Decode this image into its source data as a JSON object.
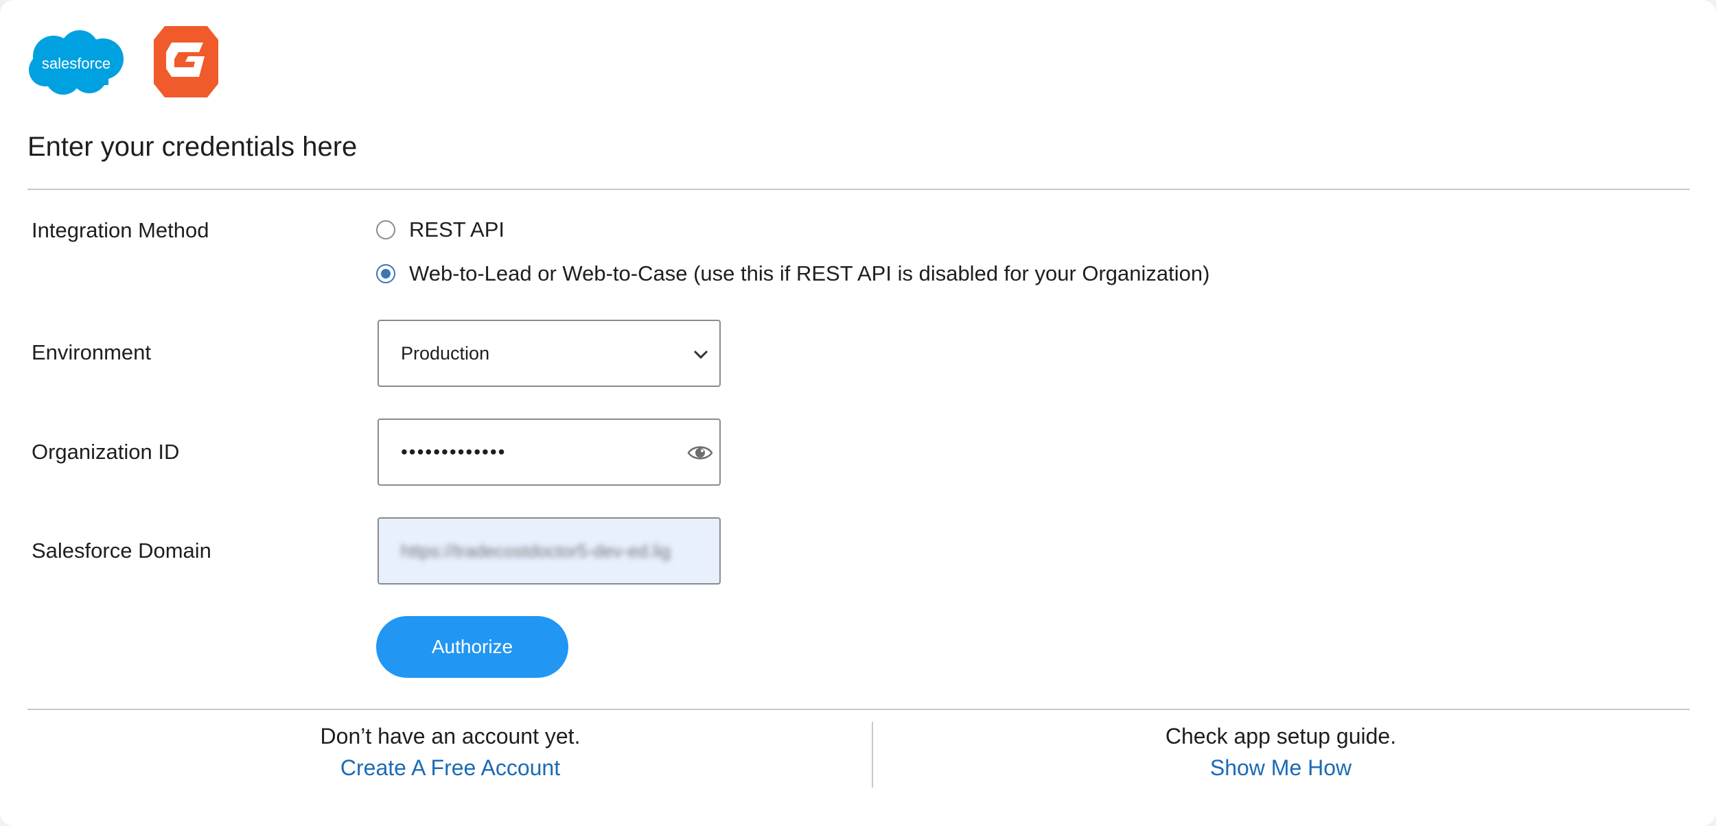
{
  "logos": {
    "salesforce_text": "salesforce",
    "salesforce_color": "#00a1e0",
    "gravity_color": "#f15a2b"
  },
  "header": {
    "title": "Enter your credentials here"
  },
  "form": {
    "integration_method": {
      "label": "Integration Method",
      "options": [
        {
          "label": "REST API",
          "checked": false
        },
        {
          "label": "Web-to-Lead or Web-to-Case (use this if REST API is disabled for your Organization)",
          "checked": true
        }
      ]
    },
    "environment": {
      "label": "Environment",
      "selected": "Production"
    },
    "organization_id": {
      "label": "Organization ID",
      "masked_value": "•••••••••••••"
    },
    "salesforce_domain": {
      "label": "Salesforce Domain",
      "value": "https://tradecostdoctor5-dev-ed.lig"
    },
    "authorize_label": "Authorize"
  },
  "footer": {
    "left_text": "Don’t have an account yet.",
    "left_link": "Create A Free Account",
    "right_text": "Check app setup guide.",
    "right_link": "Show Me How"
  },
  "colors": {
    "accent": "#2196f3",
    "link": "#1a6bb5",
    "radio_checked": "#3c74b8"
  }
}
